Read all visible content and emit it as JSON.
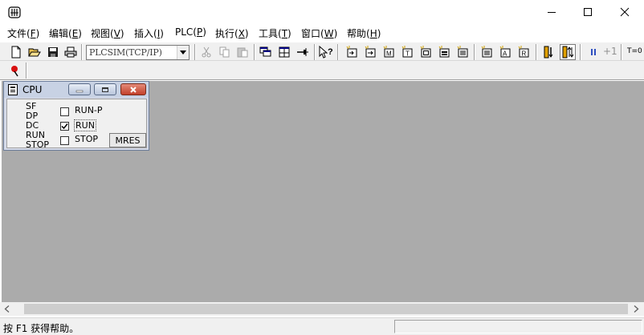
{
  "window": {
    "minimize_glyph": "—",
    "maximize_glyph": "☐",
    "close_glyph": "✕"
  },
  "menu": [
    {
      "pre": "文件(",
      "key": "F",
      "post": ")"
    },
    {
      "pre": "编辑(",
      "key": "E",
      "post": ")"
    },
    {
      "pre": "视图(",
      "key": "V",
      "post": ")"
    },
    {
      "pre": "插入(",
      "key": "I",
      "post": ")"
    },
    {
      "pre": "PLC(",
      "key": "P",
      "post": ")"
    },
    {
      "pre": "执行(",
      "key": "X",
      "post": ")"
    },
    {
      "pre": "工具(",
      "key": "T",
      "post": ")"
    },
    {
      "pre": "窗口(",
      "key": "W",
      "post": ")"
    },
    {
      "pre": "帮助(",
      "key": "H",
      "post": ")"
    }
  ],
  "toolbar": {
    "target_value": "PLCSIM(TCP/IP)",
    "step_label": "+1",
    "timer_label": "T=0"
  },
  "cpu": {
    "title": "CPU",
    "leds": [
      "SF",
      "DP",
      "DC",
      "RUN",
      "STOP"
    ],
    "modes": [
      {
        "label": "RUN-P",
        "checked": false
      },
      {
        "label": "RUN",
        "checked": true
      },
      {
        "label": "STOP",
        "checked": false
      }
    ],
    "mres_label": "MRES"
  },
  "status": {
    "text": "按 F1 获得帮助。"
  },
  "colors": {
    "workspace": "#ababab",
    "toolbar": "#f0f0f0",
    "cpu_window": "#d6dbe9",
    "close_red": "#c2402a"
  }
}
